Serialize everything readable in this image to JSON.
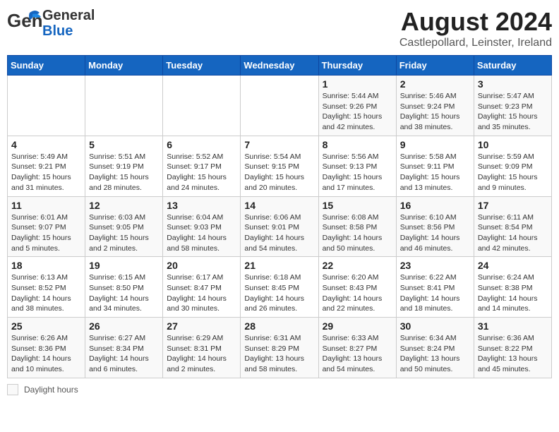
{
  "header": {
    "logo_text_general": "General",
    "logo_text_blue": "Blue",
    "title": "August 2024",
    "subtitle": "Castlepollard, Leinster, Ireland"
  },
  "calendar": {
    "days_of_week": [
      "Sunday",
      "Monday",
      "Tuesday",
      "Wednesday",
      "Thursday",
      "Friday",
      "Saturday"
    ],
    "weeks": [
      [
        {
          "day": "",
          "info": ""
        },
        {
          "day": "",
          "info": ""
        },
        {
          "day": "",
          "info": ""
        },
        {
          "day": "",
          "info": ""
        },
        {
          "day": "1",
          "info": "Sunrise: 5:44 AM\nSunset: 9:26 PM\nDaylight: 15 hours and 42 minutes."
        },
        {
          "day": "2",
          "info": "Sunrise: 5:46 AM\nSunset: 9:24 PM\nDaylight: 15 hours and 38 minutes."
        },
        {
          "day": "3",
          "info": "Sunrise: 5:47 AM\nSunset: 9:23 PM\nDaylight: 15 hours and 35 minutes."
        }
      ],
      [
        {
          "day": "4",
          "info": "Sunrise: 5:49 AM\nSunset: 9:21 PM\nDaylight: 15 hours and 31 minutes."
        },
        {
          "day": "5",
          "info": "Sunrise: 5:51 AM\nSunset: 9:19 PM\nDaylight: 15 hours and 28 minutes."
        },
        {
          "day": "6",
          "info": "Sunrise: 5:52 AM\nSunset: 9:17 PM\nDaylight: 15 hours and 24 minutes."
        },
        {
          "day": "7",
          "info": "Sunrise: 5:54 AM\nSunset: 9:15 PM\nDaylight: 15 hours and 20 minutes."
        },
        {
          "day": "8",
          "info": "Sunrise: 5:56 AM\nSunset: 9:13 PM\nDaylight: 15 hours and 17 minutes."
        },
        {
          "day": "9",
          "info": "Sunrise: 5:58 AM\nSunset: 9:11 PM\nDaylight: 15 hours and 13 minutes."
        },
        {
          "day": "10",
          "info": "Sunrise: 5:59 AM\nSunset: 9:09 PM\nDaylight: 15 hours and 9 minutes."
        }
      ],
      [
        {
          "day": "11",
          "info": "Sunrise: 6:01 AM\nSunset: 9:07 PM\nDaylight: 15 hours and 5 minutes."
        },
        {
          "day": "12",
          "info": "Sunrise: 6:03 AM\nSunset: 9:05 PM\nDaylight: 15 hours and 2 minutes."
        },
        {
          "day": "13",
          "info": "Sunrise: 6:04 AM\nSunset: 9:03 PM\nDaylight: 14 hours and 58 minutes."
        },
        {
          "day": "14",
          "info": "Sunrise: 6:06 AM\nSunset: 9:01 PM\nDaylight: 14 hours and 54 minutes."
        },
        {
          "day": "15",
          "info": "Sunrise: 6:08 AM\nSunset: 8:58 PM\nDaylight: 14 hours and 50 minutes."
        },
        {
          "day": "16",
          "info": "Sunrise: 6:10 AM\nSunset: 8:56 PM\nDaylight: 14 hours and 46 minutes."
        },
        {
          "day": "17",
          "info": "Sunrise: 6:11 AM\nSunset: 8:54 PM\nDaylight: 14 hours and 42 minutes."
        }
      ],
      [
        {
          "day": "18",
          "info": "Sunrise: 6:13 AM\nSunset: 8:52 PM\nDaylight: 14 hours and 38 minutes."
        },
        {
          "day": "19",
          "info": "Sunrise: 6:15 AM\nSunset: 8:50 PM\nDaylight: 14 hours and 34 minutes."
        },
        {
          "day": "20",
          "info": "Sunrise: 6:17 AM\nSunset: 8:47 PM\nDaylight: 14 hours and 30 minutes."
        },
        {
          "day": "21",
          "info": "Sunrise: 6:18 AM\nSunset: 8:45 PM\nDaylight: 14 hours and 26 minutes."
        },
        {
          "day": "22",
          "info": "Sunrise: 6:20 AM\nSunset: 8:43 PM\nDaylight: 14 hours and 22 minutes."
        },
        {
          "day": "23",
          "info": "Sunrise: 6:22 AM\nSunset: 8:41 PM\nDaylight: 14 hours and 18 minutes."
        },
        {
          "day": "24",
          "info": "Sunrise: 6:24 AM\nSunset: 8:38 PM\nDaylight: 14 hours and 14 minutes."
        }
      ],
      [
        {
          "day": "25",
          "info": "Sunrise: 6:26 AM\nSunset: 8:36 PM\nDaylight: 14 hours and 10 minutes."
        },
        {
          "day": "26",
          "info": "Sunrise: 6:27 AM\nSunset: 8:34 PM\nDaylight: 14 hours and 6 minutes."
        },
        {
          "day": "27",
          "info": "Sunrise: 6:29 AM\nSunset: 8:31 PM\nDaylight: 14 hours and 2 minutes."
        },
        {
          "day": "28",
          "info": "Sunrise: 6:31 AM\nSunset: 8:29 PM\nDaylight: 13 hours and 58 minutes."
        },
        {
          "day": "29",
          "info": "Sunrise: 6:33 AM\nSunset: 8:27 PM\nDaylight: 13 hours and 54 minutes."
        },
        {
          "day": "30",
          "info": "Sunrise: 6:34 AM\nSunset: 8:24 PM\nDaylight: 13 hours and 50 minutes."
        },
        {
          "day": "31",
          "info": "Sunrise: 6:36 AM\nSunset: 8:22 PM\nDaylight: 13 hours and 45 minutes."
        }
      ]
    ]
  },
  "footer": {
    "daylight_label": "Daylight hours"
  }
}
